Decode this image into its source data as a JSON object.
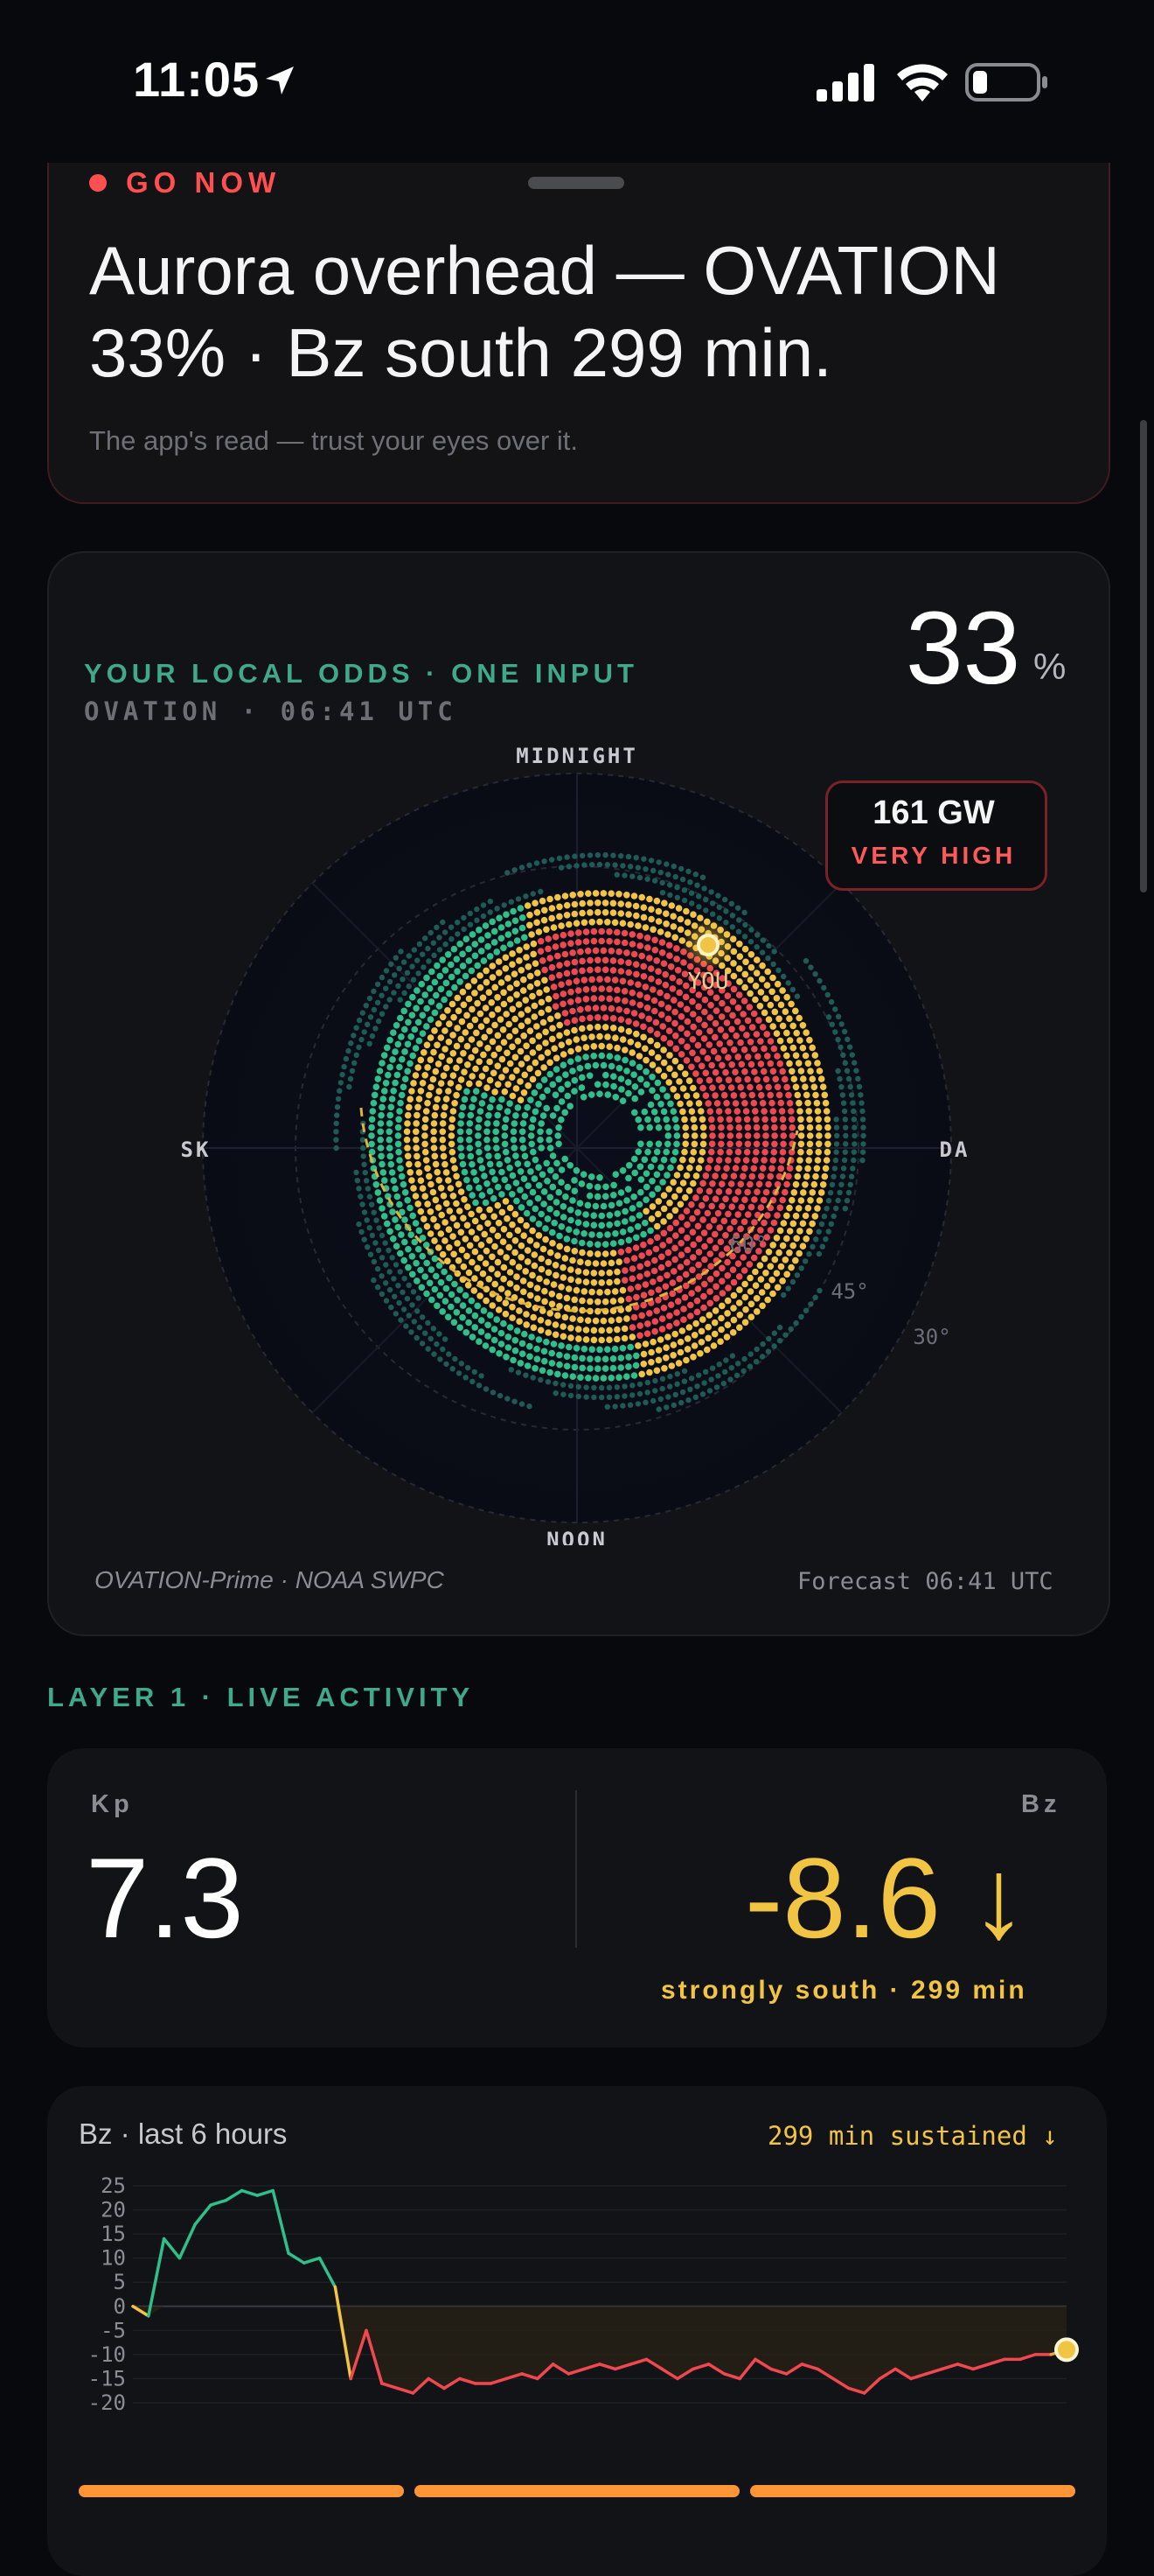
{
  "status_bar": {
    "time": "11:05",
    "icons": [
      "location-arrow-icon",
      "cellular-signal-icon",
      "wifi-icon",
      "battery-low-icon"
    ]
  },
  "alert": {
    "badge": "GO NOW",
    "headline": "Aurora overhead — OVATION 33% · Bz south 299 min.",
    "note": "The app's read — trust your eyes over it.",
    "accent": "#ff4f4f"
  },
  "odds": {
    "title": "YOUR LOCAL ODDS · ONE INPUT",
    "subtitle": "OVATION · 06:41 UTC",
    "value": "33",
    "unit": "%",
    "map": {
      "top_label": "MIDNIGHT",
      "bottom_label": "NOON",
      "left_label": "SK",
      "right_label": "DA",
      "you_label": "YOU",
      "latitude_labels": [
        "60°",
        "45°",
        "30°"
      ]
    },
    "power": {
      "value": "161 GW",
      "level": "VERY HIGH"
    },
    "source": "OVATION-Prime · NOAA SWPC",
    "forecast": "Forecast 06:41 UTC",
    "colors": {
      "strong": "#f0484f",
      "medium": "#f2c443",
      "low": "#2fbf8a",
      "faint": "#1f5a56"
    }
  },
  "layer1": {
    "label": "LAYER 1 · LIVE ACTIVITY"
  },
  "live": {
    "kp_label": "Kp",
    "kp_value": "7.3",
    "bz_label": "Bz",
    "bz_value": "-8.6",
    "bz_arrow": "↓",
    "bz_note": "strongly south · 299 min"
  },
  "bz_chart": {
    "title": "Bz · last 6 hours",
    "sustained": "299 min sustained ↓"
  },
  "chart_data": {
    "type": "line",
    "title": "Bz · last 6 hours",
    "xlabel": "",
    "ylabel": "",
    "ylim": [
      -20,
      25
    ],
    "yticks": [
      25,
      20,
      15,
      10,
      5,
      0,
      -5,
      -10,
      -15,
      -20
    ],
    "grid": true,
    "x": [
      0,
      0.1,
      0.2,
      0.3,
      0.4,
      0.5,
      0.6,
      0.7,
      0.8,
      0.9,
      1.0,
      1.1,
      1.2,
      1.3,
      1.4,
      1.5,
      1.6,
      1.7,
      1.8,
      1.9,
      2.0,
      2.1,
      2.2,
      2.3,
      2.4,
      2.5,
      2.6,
      2.7,
      2.8,
      2.9,
      3.0,
      3.1,
      3.2,
      3.3,
      3.4,
      3.5,
      3.6,
      3.7,
      3.8,
      3.9,
      4.0,
      4.1,
      4.2,
      4.3,
      4.4,
      4.5,
      4.6,
      4.7,
      4.8,
      4.9,
      5.0,
      5.1,
      5.2,
      5.3,
      5.4,
      5.5,
      5.6,
      5.7,
      5.8,
      5.9,
      6.0
    ],
    "series": [
      {
        "values": [
          0,
          -2,
          14,
          10,
          17,
          21,
          22,
          24,
          23,
          24,
          11,
          9,
          10,
          4,
          -15,
          -5,
          -16,
          -17,
          -18,
          -15,
          -17,
          -15,
          -16,
          -16,
          -15,
          -14,
          -15,
          -12,
          -14,
          -13,
          -12,
          -13,
          -12,
          -11,
          -13,
          -15,
          -13,
          -12,
          -14,
          -15,
          -11,
          -13,
          -14,
          -12,
          -13,
          -15,
          -17,
          -18,
          -15,
          -13,
          -15,
          -14,
          -13,
          -12,
          -13,
          -12,
          -11,
          -11,
          -10,
          -10,
          -9
        ]
      }
    ]
  },
  "tabs": {
    "count": 3,
    "color": "#ff9536"
  }
}
